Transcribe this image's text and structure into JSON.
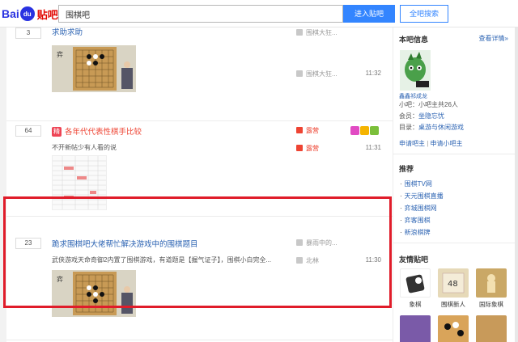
{
  "header": {
    "logo_bai": "Bai",
    "logo_paw": "du",
    "logo_tieba": "贴吧",
    "search_value": "围棋吧",
    "enter_button": "进入贴吧",
    "search_all_button": "全吧搜索"
  },
  "threads": [
    {
      "reply_count": "3",
      "title": "求助求助",
      "author": "围棋大狂...",
      "last_reply_author": "围棋大狂...",
      "time": "11:32"
    },
    {
      "reply_count": "64",
      "tag": "精",
      "title": "各年代代表性棋手比较",
      "abstract": "不开新帖少有人看的说",
      "author": "露营",
      "last_reply_author": "露营",
      "time": "11:31"
    },
    {
      "reply_count": "23",
      "title": "跪求围棋吧大佬帮忙解决游戏中的围棋题目",
      "abstract": "武侠游戏天命奇御2内置了围棋游戏，有道题是【握气证子】，围棋小白完全...",
      "author": "暴雨中的...",
      "last_reply_author": "北林",
      "time": "11:30"
    }
  ],
  "side": {
    "info_title": "本吧信息",
    "more_link": "查看详情»",
    "owner_name": "鑫鑫祁成龙",
    "assistants": "小吧：小吧主共26人",
    "members_label": "会员：",
    "members_value": "坐隐忘忧",
    "category_label": "目录：",
    "category_value": "桌游与休闲游戏",
    "apply_owner": "申请吧主",
    "link_sep": "|",
    "apply_assistant": "申请小吧主",
    "recommend_title": "推荐",
    "recommend_items": [
      "围棋TV网",
      "天元围棋直播",
      "弈城围棋网",
      "弈客围棋",
      "新浪棋牌"
    ],
    "friends_title": "友情贴吧",
    "friends": [
      {
        "label": "象棋",
        "color": "#333333"
      },
      {
        "label": "围棋新人",
        "color": "#e6d9b8"
      },
      {
        "label": "国际象棋",
        "color": "#caa866"
      },
      {
        "label": "",
        "color": "#7a5aa8"
      },
      {
        "label": "",
        "color": "#d9a45a"
      },
      {
        "label": "",
        "color": "#c89a5a"
      }
    ]
  },
  "colors": {
    "accent": "#3385ff",
    "highlight_border": "#e01c2a",
    "link": "#2d64b3"
  }
}
